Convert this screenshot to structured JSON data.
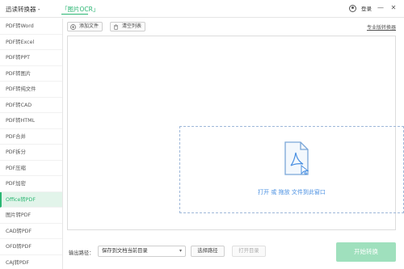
{
  "titlebar": {
    "app_title": "迅读转换器 -",
    "promo_link": "「图片OCR」",
    "login_label": "登录",
    "minimize_glyph": "—",
    "close_glyph": "✕",
    "user_icon": "user-icon"
  },
  "sidebar": {
    "items": [
      {
        "label": "PDF转Word"
      },
      {
        "label": "PDF转Excel"
      },
      {
        "label": "PDF转PPT"
      },
      {
        "label": "PDF转图片"
      },
      {
        "label": "PDF转纯文件"
      },
      {
        "label": "PDF转CAD"
      },
      {
        "label": "PDF转HTML"
      },
      {
        "label": "PDF合并"
      },
      {
        "label": "PDF拆分"
      },
      {
        "label": "PDF压缩"
      },
      {
        "label": "PDF加密"
      },
      {
        "label": "Office转PDF"
      },
      {
        "label": "图片转PDF"
      },
      {
        "label": "CAD转PDF"
      },
      {
        "label": "OFD转PDF"
      },
      {
        "label": "CAJ转PDF"
      }
    ],
    "active_index": 11
  },
  "toolbar": {
    "add_file_label": "添加文件",
    "clear_list_label": "清空列表",
    "pro_link_label": "专业版转换器"
  },
  "dropzone": {
    "text": "打开 或 拖放 文件到此窗口",
    "icon": "pdf-file-icon"
  },
  "output": {
    "label": "输出路径：",
    "selected_option": "保存到文档当前目录",
    "choose_path_label": "选择路径",
    "open_dir_label": "打开目录"
  },
  "start_button_label": "开始转换",
  "colors": {
    "accent": "#2bb673",
    "active_bg": "#e2f4ea",
    "start_disabled": "#9fe0bd",
    "drop_text": "#4a90e2"
  }
}
